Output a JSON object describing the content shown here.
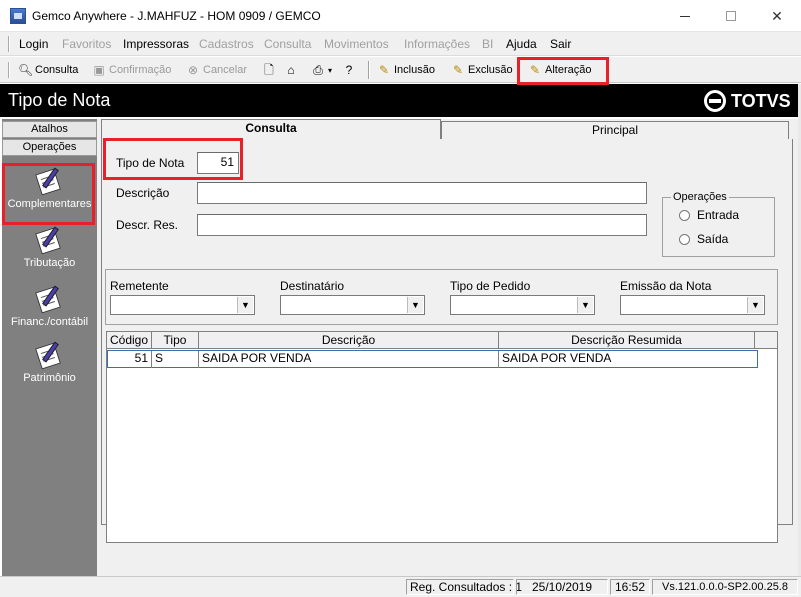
{
  "window": {
    "title": "Gemco Anywhere - J.MAHFUZ - HOM 0909 / GEMCO",
    "close_glyph": "✕"
  },
  "menu": {
    "items": [
      {
        "label": "Login",
        "enabled": true
      },
      {
        "label": "Favoritos",
        "enabled": false
      },
      {
        "label": "Impressoras",
        "enabled": true
      },
      {
        "label": "Cadastros",
        "enabled": false
      },
      {
        "label": "Consulta",
        "enabled": false
      },
      {
        "label": "Movimentos",
        "enabled": false
      },
      {
        "label": "Informações",
        "enabled": false
      },
      {
        "label": "BI",
        "enabled": false
      },
      {
        "label": "Ajuda",
        "enabled": true
      },
      {
        "label": "Sair",
        "enabled": true
      }
    ]
  },
  "toolbar": {
    "consulta": "Consulta",
    "confirmacao": "Confirmação",
    "cancelar": "Cancelar",
    "inclusao": "Inclusão",
    "exclusao": "Exclusão",
    "alteracao": "Alteração"
  },
  "header": {
    "title": "Tipo de Nota",
    "brand": "TOTVS"
  },
  "sidebar": {
    "atalhos": "Atalhos",
    "operacoes": "Operações",
    "items": [
      {
        "label": "Complementares",
        "icon": "document-pen-icon"
      },
      {
        "label": "Tributação",
        "icon": "document-pen-icon"
      },
      {
        "label": "Financ./contábil",
        "icon": "document-pen-icon"
      },
      {
        "label": "Patrimônio",
        "icon": "document-pen-icon"
      }
    ]
  },
  "tabs": {
    "consulta": "Consulta",
    "principal": "Principal"
  },
  "form": {
    "tipo_nota_label": "Tipo de Nota",
    "tipo_nota_value": "51",
    "descricao_label": "Descrição",
    "descricao_value": "",
    "descr_res_label": "Descr. Res.",
    "descr_res_value": "",
    "operacoes_legend": "Operações",
    "entrada": "Entrada",
    "saida": "Saída"
  },
  "filters": {
    "remetente": "Remetente",
    "destinatario": "Destinatário",
    "tipo_pedido": "Tipo de Pedido",
    "emissao": "Emissão da Nota"
  },
  "grid": {
    "columns": [
      "Código",
      "Tipo",
      "Descrição",
      "Descrição Resumida"
    ],
    "rows": [
      {
        "codigo": "51",
        "tipo": "S",
        "descricao": "SAIDA POR VENDA",
        "descricao_resumida": "SAIDA POR VENDA"
      }
    ]
  },
  "status": {
    "registros": "Reg. Consultados : 1",
    "date": "25/10/2019",
    "time": "16:52",
    "version": "Vs.121.0.0.0-SP2.00.25.8"
  },
  "colors": {
    "highlight": "#e8202a",
    "header_bg": "#000000",
    "sidebar_bg": "#808080",
    "panel_bg": "#f0f0f0"
  }
}
